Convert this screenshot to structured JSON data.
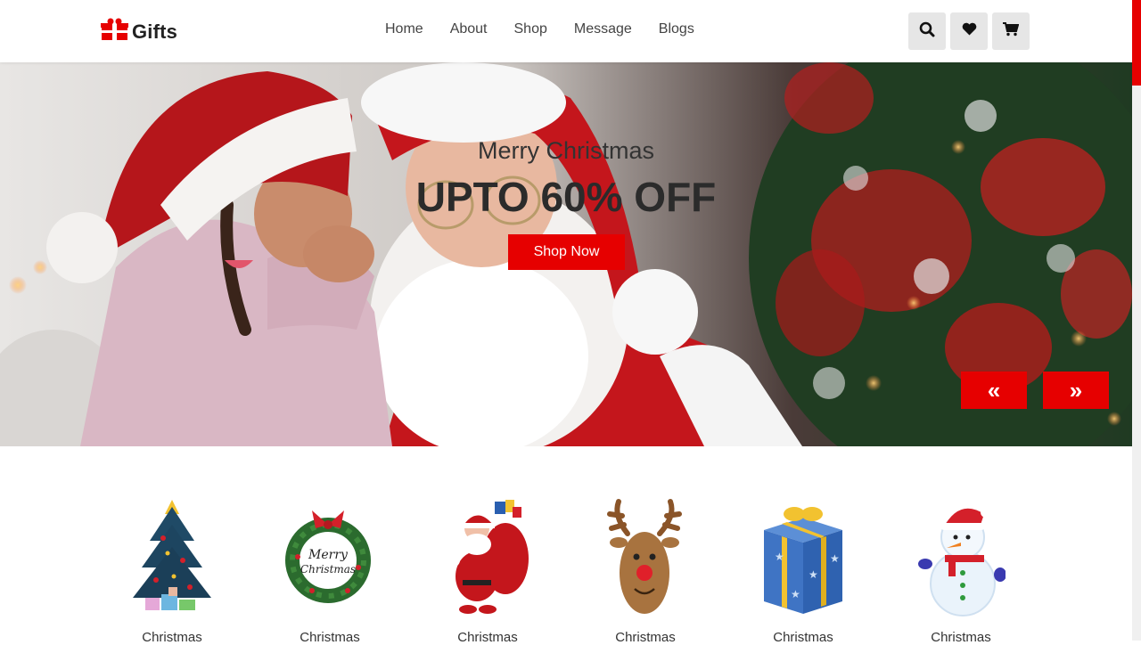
{
  "brand": {
    "name": "Gifts",
    "accent": "#e60000"
  },
  "nav": {
    "items": [
      {
        "label": "Home"
      },
      {
        "label": "About"
      },
      {
        "label": "Shop"
      },
      {
        "label": "Message"
      },
      {
        "label": "Blogs"
      }
    ]
  },
  "actions": {
    "icons": [
      "search-icon",
      "heart-icon",
      "cart-icon"
    ]
  },
  "hero": {
    "subtitle": "Merry Christmas",
    "title": "UPTO 60% OFF",
    "cta": "Shop Now",
    "prev": "«",
    "next": "»"
  },
  "categories": [
    {
      "label": "Christmas",
      "icon": "christmas-tree-icon"
    },
    {
      "label": "Christmas",
      "icon": "wreath-icon"
    },
    {
      "label": "Christmas",
      "icon": "santa-icon"
    },
    {
      "label": "Christmas",
      "icon": "reindeer-icon"
    },
    {
      "label": "Christmas",
      "icon": "gift-box-icon"
    },
    {
      "label": "Christmas",
      "icon": "snowman-icon"
    }
  ]
}
